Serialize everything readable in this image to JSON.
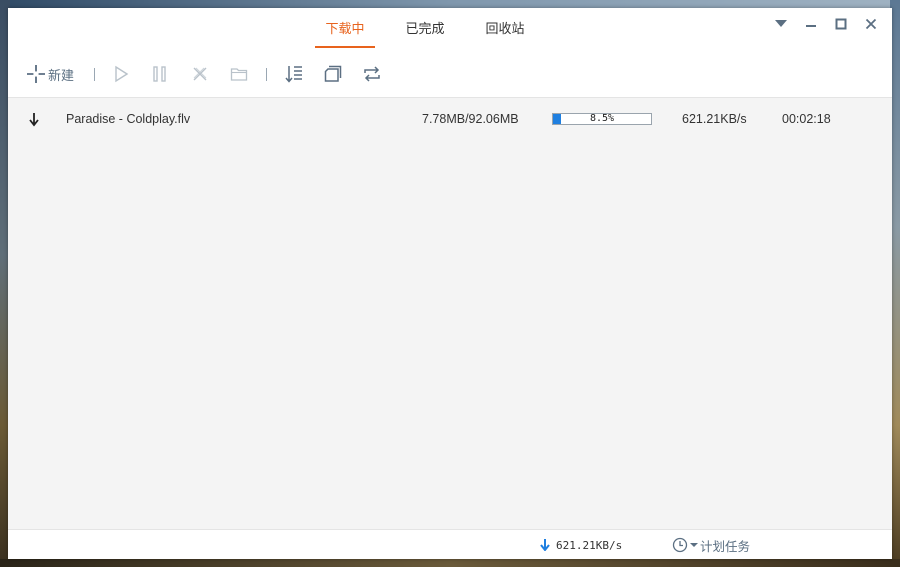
{
  "tabs": [
    {
      "label": "下载中",
      "active": true
    },
    {
      "label": "已完成",
      "active": false
    },
    {
      "label": "回收站",
      "active": false
    }
  ],
  "window_controls": [
    "menu-dropdown",
    "minimize",
    "maximize",
    "close"
  ],
  "toolbar": {
    "new_label": "新建",
    "buttons": [
      "add-icon",
      "start-icon",
      "pause-icon",
      "delete-icon",
      "open-folder-icon",
      "sort-icon",
      "copy-icon",
      "refresh-icon"
    ]
  },
  "downloads": [
    {
      "status_icon": "download-arrow-icon",
      "name": "Paradise - Coldplay.flv",
      "size": "7.78MB/92.06MB",
      "progress_percent": 8.5,
      "progress_label": "8.5%",
      "speed": "621.21KB/s",
      "time_remaining": "00:02:18"
    }
  ],
  "statusbar": {
    "total_speed": "621.21KB/s",
    "schedule_label": "计划任务"
  },
  "colors": {
    "accent": "#e8631d",
    "progress": "#1f7fe0",
    "icon": "#5b6f82",
    "status_arrow": "#1f7fe0"
  }
}
